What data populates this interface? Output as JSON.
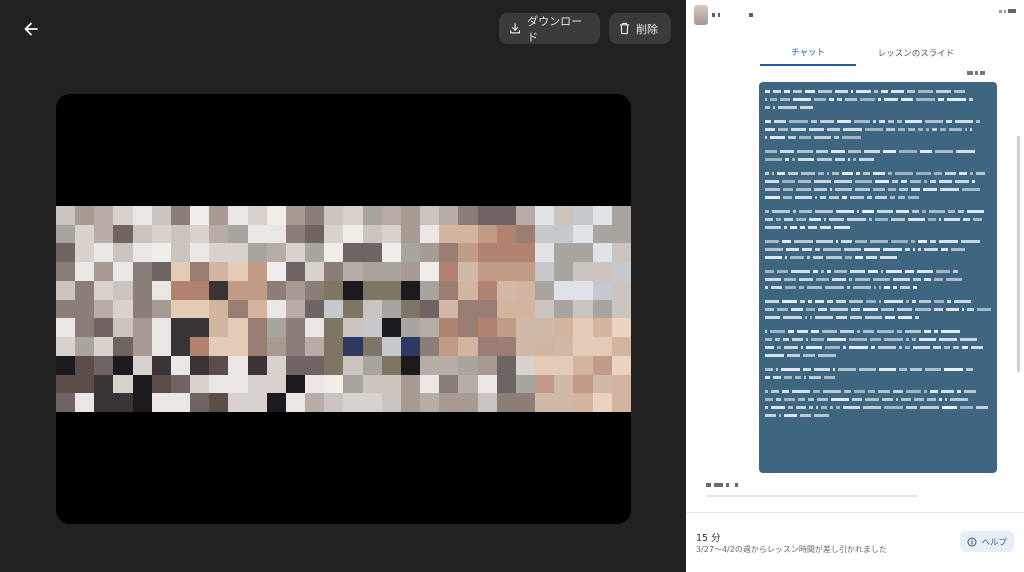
{
  "toolbar": {
    "download_label": "ダウンロード",
    "delete_label": "削除",
    "back_icon": "arrow-left-icon",
    "download_icon": "download-icon",
    "delete_icon": "trash-icon"
  },
  "panel": {
    "tabs": [
      {
        "label": "チャット",
        "active": true
      },
      {
        "label": "レッスンのスライド",
        "active": false
      }
    ],
    "footer": {
      "minutes": "15 分",
      "note": "3/27〜4/2の週からレッスン時間が差し引かれました",
      "help_label": "ヘルプ",
      "help_icon": "info-circle-icon"
    }
  },
  "colors": {
    "accent": "#1e5ba8",
    "bubble": "#3e6680",
    "viewer_bg": "#212121"
  }
}
